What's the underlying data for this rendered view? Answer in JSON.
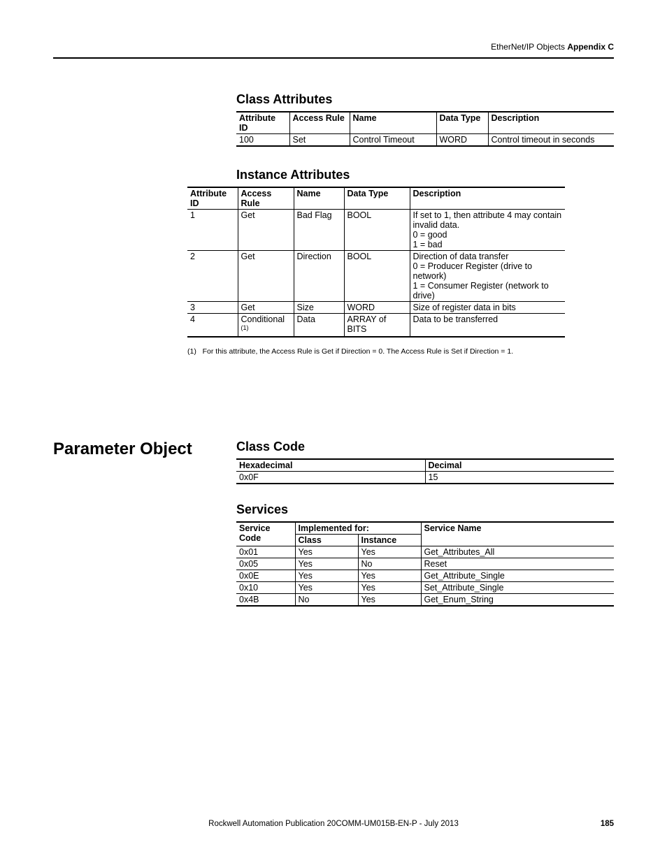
{
  "header": {
    "left": "EtherNet/IP Objects",
    "right": "Appendix C"
  },
  "sections": {
    "classAttr": {
      "title": "Class Attributes",
      "cols": [
        "Attribute ID",
        "Access Rule",
        "Name",
        "Data Type",
        "Description"
      ],
      "rows": [
        {
          "id": "100",
          "rule": "Set",
          "name": "Control Timeout",
          "type": "WORD",
          "desc": [
            "Control timeout in seconds"
          ]
        }
      ]
    },
    "instAttr": {
      "title": "Instance Attributes",
      "cols": [
        "Attribute ID",
        "Access Rule",
        "Name",
        "Data Type",
        "Description"
      ],
      "rows": [
        {
          "id": "1",
          "rule": "Get",
          "name": "Bad Flag",
          "type": "BOOL",
          "desc": [
            "If set to 1, then attribute 4 may contain invalid data.",
            "0 = good",
            "1 = bad"
          ]
        },
        {
          "id": "2",
          "rule": "Get",
          "name": "Direction",
          "type": "BOOL",
          "desc": [
            "Direction of data transfer",
            "0 = Producer Register (drive to network)",
            "1 = Consumer Register (network to drive)"
          ]
        },
        {
          "id": "3",
          "rule": "Get",
          "name": "Size",
          "type": "WORD",
          "desc": [
            "Size of register data in bits"
          ]
        },
        {
          "id": "4",
          "rule": "Conditional",
          "ruleSup": "(1)",
          "name": "Data",
          "type": "ARRAY of BITS",
          "desc": [
            "Data to be transferred"
          ]
        }
      ],
      "footnote": {
        "marker": "(1)",
        "text": "For this attribute, the Access Rule is Get if Direction = 0. The Access Rule is Set if Direction = 1."
      }
    },
    "paramObj": {
      "sideTitle": "Parameter Object",
      "classCode": {
        "title": "Class Code",
        "cols": [
          "Hexadecimal",
          "Decimal"
        ],
        "rows": [
          {
            "hex": "0x0F",
            "dec": "15"
          }
        ]
      },
      "services": {
        "title": "Services",
        "cols": {
          "code": "Service Code",
          "impl": "Implemented for:",
          "cls": "Class",
          "inst": "Instance",
          "name": "Service Name"
        },
        "rows": [
          {
            "code": "0x01",
            "cls": "Yes",
            "inst": "Yes",
            "name": "Get_Attributes_All"
          },
          {
            "code": "0x05",
            "cls": "Yes",
            "inst": "No",
            "name": "Reset"
          },
          {
            "code": "0x0E",
            "cls": "Yes",
            "inst": "Yes",
            "name": "Get_Attribute_Single"
          },
          {
            "code": "0x10",
            "cls": "Yes",
            "inst": "Yes",
            "name": "Set_Attribute_Single"
          },
          {
            "code": "0x4B",
            "cls": "No",
            "inst": "Yes",
            "name": "Get_Enum_String"
          }
        ]
      }
    }
  },
  "footer": {
    "pub": "Rockwell Automation Publication  20COMM-UM015B-EN-P - July 2013",
    "page": "185"
  }
}
